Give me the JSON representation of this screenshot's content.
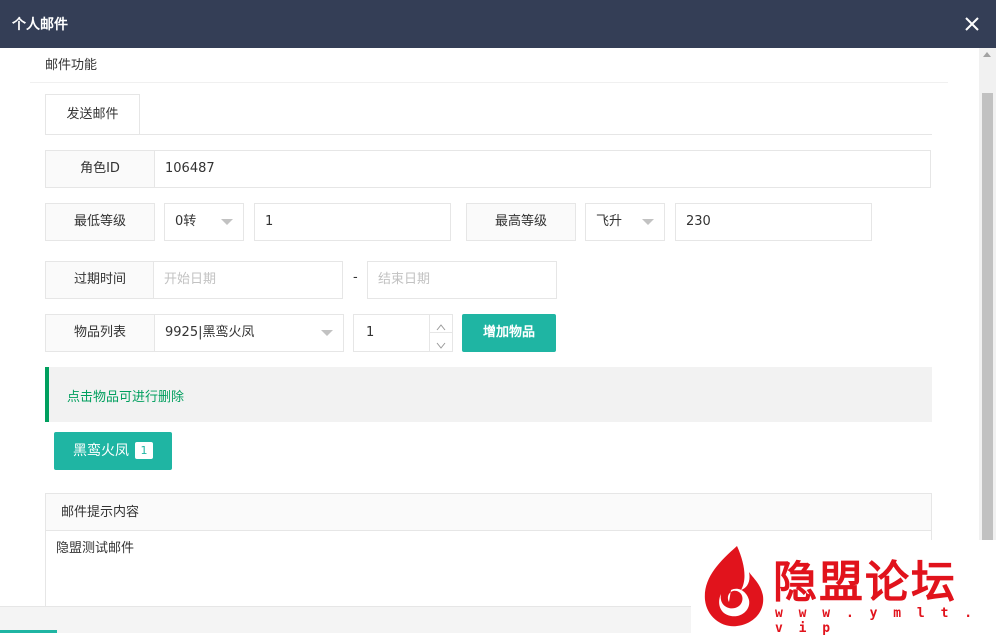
{
  "window": {
    "title": "个人邮件"
  },
  "panel": {
    "title": "邮件功能"
  },
  "tabs": [
    {
      "label": "发送邮件"
    }
  ],
  "form": {
    "role_id": {
      "label": "角色ID",
      "value": "106487"
    },
    "min_level": {
      "label": "最低等级",
      "select": "0转",
      "value": "1"
    },
    "max_level": {
      "label": "最高等级",
      "select": "飞升",
      "value": "230"
    },
    "expire": {
      "label": "过期时间",
      "start_placeholder": "开始日期",
      "separator": "-",
      "end_placeholder": "结束日期"
    },
    "items": {
      "label": "物品列表",
      "select": "9925|黑鸾火凤",
      "quantity": "1",
      "add_button": "增加物品"
    }
  },
  "notice": {
    "text": "点击物品可进行删除"
  },
  "added_items": [
    {
      "name": "黑鸾火凤",
      "count": "1"
    }
  ],
  "content": {
    "label": "邮件提示内容",
    "value": "隐盟测试邮件"
  },
  "watermark": {
    "text": "隐盟论坛",
    "url": "w w w . y m l t . v i p"
  },
  "colors": {
    "titlebar": "#343e56",
    "accent": "#1fb5a3",
    "notice_green": "#009f5e",
    "watermark_red": "#e1131c"
  }
}
